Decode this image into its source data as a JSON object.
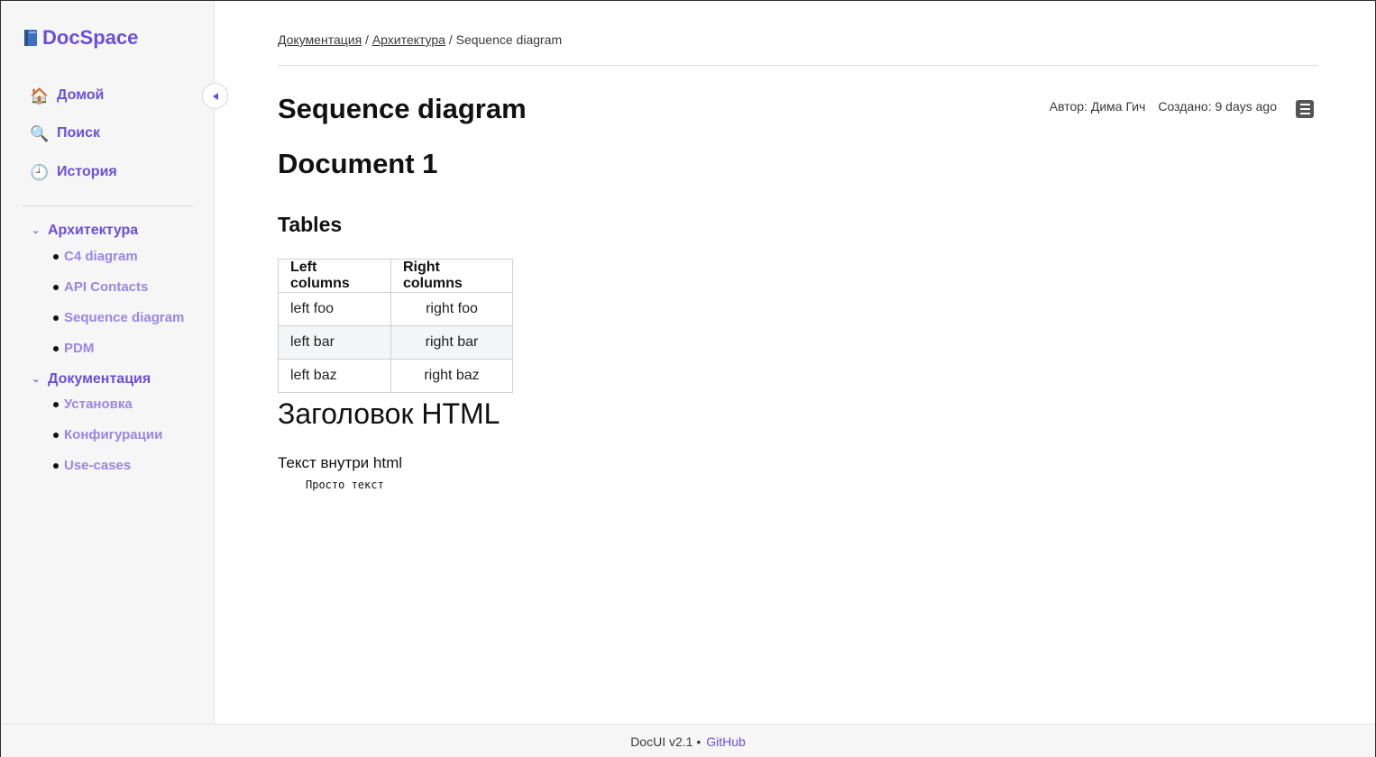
{
  "sidebar": {
    "logo_icon": "book-icon",
    "logo_text": "DocSpace",
    "nav": [
      {
        "emoji": "🏠",
        "label": "Домой"
      },
      {
        "emoji": "🔍",
        "label": "Поиск"
      },
      {
        "emoji": "🕘",
        "label": "История"
      }
    ],
    "sections": [
      {
        "label": "Архитектура",
        "items": [
          "C4 diagram",
          "API Contacts",
          "Sequence diagram",
          "PDM"
        ]
      },
      {
        "label": "Документация",
        "items": [
          "Установка",
          "Конфигурации",
          "Use-cases"
        ]
      }
    ]
  },
  "breadcrumb": {
    "part1": "Документация",
    "sep": " / ",
    "part2": "Архитектура",
    "current": "Sequence diagram"
  },
  "page": {
    "title": "Sequence diagram",
    "author": "Автор: Дима Гич",
    "created": "Создано: 9 days ago",
    "h1": "Document 1",
    "h3": "Tables",
    "table": {
      "headers": [
        "Left columns",
        "Right columns"
      ],
      "rows": [
        [
          "left foo",
          "right foo"
        ],
        [
          "left bar",
          "right bar"
        ],
        [
          "left baz",
          "right baz"
        ]
      ]
    },
    "html_heading": "Заголовок HTML",
    "html_text": "Текст внутри html",
    "pre_text": "Просто текст"
  },
  "footer": {
    "version": "DocUI v2.1 •",
    "github": "GitHub"
  },
  "colors": {
    "accent": "#6b4fd8",
    "accent_light": "#9a86e6"
  }
}
